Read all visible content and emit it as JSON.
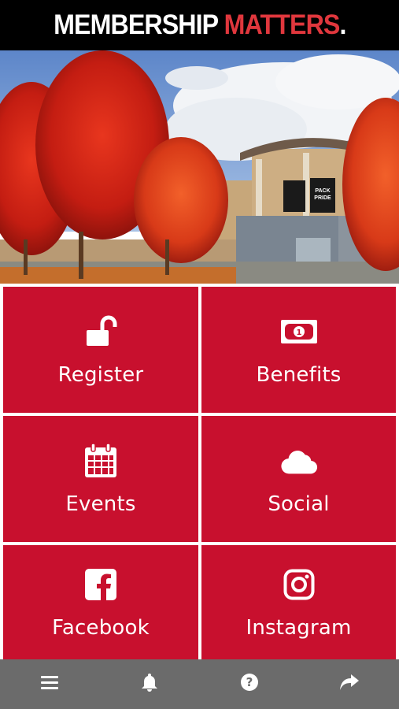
{
  "header": {
    "title_part1": "MEMBERSHIP",
    "title_part2": "MATTERS",
    "title_punct": "."
  },
  "hero": {
    "banner_line1": "PACK",
    "banner_line2": "PRIDE"
  },
  "tiles": [
    {
      "label": "Register",
      "icon": "unlock-icon"
    },
    {
      "label": "Benefits",
      "icon": "money-icon"
    },
    {
      "label": "Events",
      "icon": "calendar-icon"
    },
    {
      "label": "Social",
      "icon": "cloud-icon"
    },
    {
      "label": "Facebook",
      "icon": "facebook-icon"
    },
    {
      "label": "Instagram",
      "icon": "instagram-icon"
    }
  ],
  "toolbar": {
    "items": [
      "menu-icon",
      "bell-icon",
      "help-icon",
      "share-icon"
    ]
  },
  "colors": {
    "tile": "#c8102e",
    "accent": "#e0373d",
    "header": "#000000",
    "toolbar": "#6b6b6b"
  }
}
